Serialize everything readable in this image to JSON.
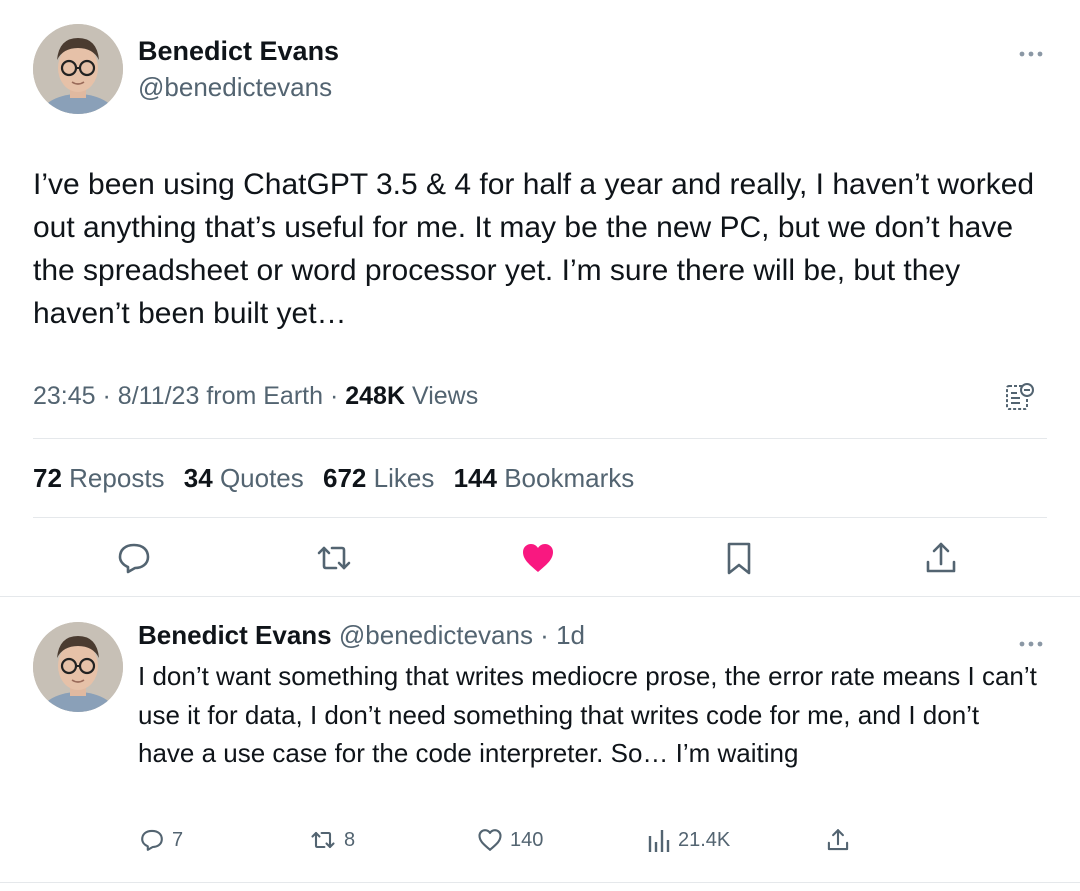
{
  "main_tweet": {
    "author_name": "Benedict Evans",
    "author_handle": "@benedictevans",
    "more_icon": "more-dots-icon",
    "text": "I’ve been using ChatGPT 3.5 & 4 for half a year and really, I haven’t worked out anything that’s useful for me.  It may be the new PC, but we don’t have the spreadsheet or word processor yet. I’m sure there will be, but they haven’t been built yet…",
    "time": "23:45",
    "date": "8/11/23",
    "source": "from Earth",
    "views_count": "248K",
    "views_label": "Views",
    "stats": {
      "reposts_count": "72",
      "reposts_label": "Reposts",
      "quotes_count": "34",
      "quotes_label": "Quotes",
      "likes_count": "672",
      "likes_label": "Likes",
      "bookmarks_count": "144",
      "bookmarks_label": "Bookmarks"
    },
    "liked": true,
    "colors": {
      "like_active": "#f91880",
      "secondary_text": "#536471",
      "primary_text": "#0f1419",
      "divider": "#e5e8eb"
    }
  },
  "reply_tweet": {
    "author_name": "Benedict Evans",
    "author_handle": "@benedictevans",
    "age": "1d",
    "text": "I don’t want something that writes mediocre prose,  the error rate means I can’t use it for data, I don’t need something that writes code for me, and I don’t have a use case for the code interpreter. So… I’m waiting",
    "replies": "7",
    "reposts": "8",
    "likes": "140",
    "views": "21.4K"
  }
}
